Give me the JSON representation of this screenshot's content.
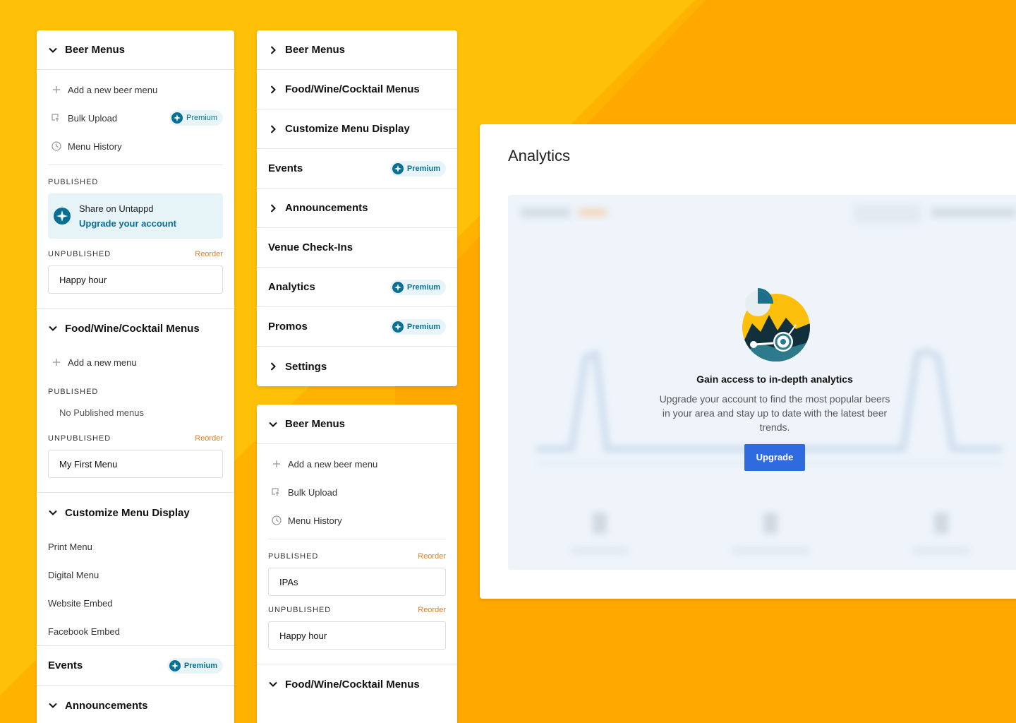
{
  "colors": {
    "accent": "#0b6e93",
    "reorder": "#e67e22",
    "upgrade": "#2f6bde",
    "background": "#ffc107"
  },
  "premium_label": "Premium",
  "panel1": {
    "beer": {
      "title": "Beer Menus",
      "add": "Add a new beer menu",
      "bulk": "Bulk Upload",
      "history": "Menu History",
      "published": "PUBLISHED",
      "share_title": "Share on Untappd",
      "share_link": "Upgrade your account",
      "unpublished": "UNPUBLISHED",
      "reorder": "Reorder",
      "unpub_item": "Happy hour"
    },
    "food": {
      "title": "Food/Wine/Cocktail Menus",
      "add": "Add a new menu",
      "published": "PUBLISHED",
      "none": "No Published menus",
      "unpublished": "UNPUBLISHED",
      "reorder": "Reorder",
      "unpub_item": "My First Menu"
    },
    "custom": {
      "title": "Customize Menu Display",
      "items": [
        "Print Menu",
        "Digital Menu",
        "Website Embed",
        "Facebook Embed"
      ]
    },
    "events": "Events",
    "announcements": "Announcements"
  },
  "panel2": {
    "items": [
      {
        "label": "Beer Menus"
      },
      {
        "label": "Food/Wine/Cocktail Menus"
      },
      {
        "label": "Customize Menu Display"
      },
      {
        "label": "Events"
      },
      {
        "label": "Announcements"
      },
      {
        "label": "Venue Check-Ins"
      },
      {
        "label": "Analytics"
      },
      {
        "label": "Promos"
      },
      {
        "label": "Settings"
      }
    ]
  },
  "panel3": {
    "title": "Beer Menus",
    "add": "Add a new beer menu",
    "bulk": "Bulk Upload",
    "history": "Menu History",
    "published": "PUBLISHED",
    "reorder1": "Reorder",
    "pub_item": "IPAs",
    "unpublished": "UNPUBLISHED",
    "reorder2": "Reorder",
    "unpub_item": "Happy hour",
    "food_title": "Food/Wine/Cocktail Menus"
  },
  "analytics": {
    "title": "Analytics",
    "heading": "Gain access to in-depth analytics",
    "description": "Upgrade your account to find the most popular beers in your area and stay up to date with the latest beer trends.",
    "button": "Upgrade"
  }
}
